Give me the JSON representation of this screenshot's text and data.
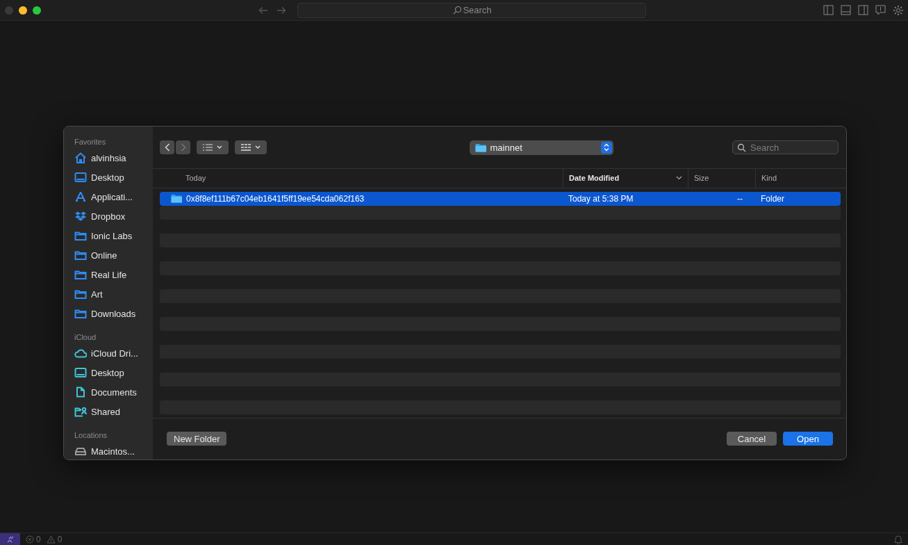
{
  "titlebar": {
    "search": {
      "placeholder": "Search"
    }
  },
  "dialog": {
    "sidebar": {
      "sections": [
        {
          "title": "Favorites",
          "color": "#2f8cf5",
          "items": [
            {
              "label": "alvinhsia",
              "kind": "home"
            },
            {
              "label": "Desktop",
              "kind": "desktop"
            },
            {
              "label": "Applicati...",
              "kind": "apps"
            },
            {
              "label": "Dropbox",
              "kind": "dropbox"
            },
            {
              "label": "Ionic Labs",
              "kind": "folder"
            },
            {
              "label": "Online",
              "kind": "folder"
            },
            {
              "label": "Real Life",
              "kind": "folder"
            },
            {
              "label": "Art",
              "kind": "folder"
            },
            {
              "label": "Downloads",
              "kind": "folder"
            }
          ]
        },
        {
          "title": "iCloud",
          "color": "#3fc4d8",
          "items": [
            {
              "label": "iCloud Dri...",
              "kind": "cloud"
            },
            {
              "label": "Desktop",
              "kind": "desktop"
            },
            {
              "label": "Documents",
              "kind": "document"
            },
            {
              "label": "Shared",
              "kind": "shared"
            }
          ]
        },
        {
          "title": "Locations",
          "color": "#9a9a9a",
          "items": [
            {
              "label": "Macintos...",
              "kind": "drive"
            }
          ]
        }
      ]
    },
    "toolbar": {
      "location": "mainnet",
      "search": {
        "placeholder": "Search"
      }
    },
    "table": {
      "columns": [
        {
          "label": "Today",
          "sorted": false
        },
        {
          "label": "Date Modified",
          "sorted": true
        },
        {
          "label": "Size",
          "sorted": false
        },
        {
          "label": "Kind",
          "sorted": false
        }
      ],
      "rows": [
        {
          "name": "0x8f8ef111b67c04eb1641f5ff19ee54cda062f163",
          "date": "Today at 5:38 PM",
          "size": "--",
          "kind": "Folder",
          "selected": true
        }
      ]
    },
    "buttons": [
      {
        "label": "New Folder",
        "kind": "secondary"
      },
      {
        "label": "Cancel",
        "kind": "secondary"
      },
      {
        "label": "Open",
        "kind": "primary"
      }
    ]
  },
  "status_bar": {
    "errors": "0",
    "warnings": "0"
  }
}
